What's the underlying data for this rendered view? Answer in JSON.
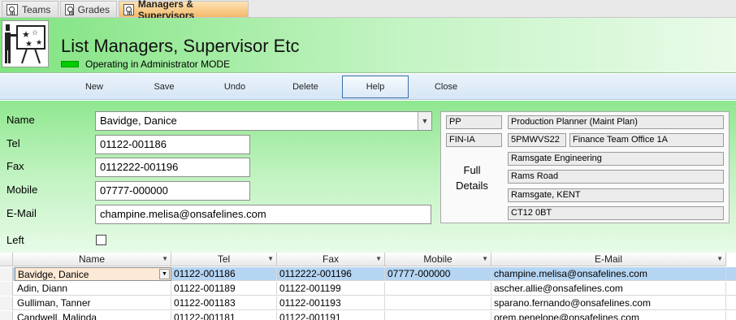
{
  "tabs": [
    {
      "label": "Teams",
      "active": false
    },
    {
      "label": "Grades",
      "active": false
    },
    {
      "label": "Managers & Supervisors",
      "active": true
    }
  ],
  "header": {
    "title": "List Managers, Supervisor Etc",
    "mode_text": "Operating in Administrator MODE",
    "mode_color": "#00cc00"
  },
  "toolbar": {
    "new_label": "New",
    "save_label": "Save",
    "undo_label": "Undo",
    "delete_label": "Delete",
    "help_label": "Help",
    "close_label": "Close"
  },
  "form": {
    "name_label": "Name",
    "name_value": "Bavidge, Danice",
    "tel_label": "Tel",
    "tel_value": "01122-001186",
    "fax_label": "Fax",
    "fax_value": "0112222-001196",
    "mobile_label": "Mobile",
    "mobile_value": "07777-000000",
    "email_label": "E-Mail",
    "email_value": "champine.melisa@onsafelines.com",
    "left_label": "Left",
    "left_checked": false
  },
  "details": {
    "full_details_label": "Full Details",
    "grade_code": "PP",
    "grade_name": "Production Planner (Maint Plan)",
    "team_code": "FIN-IA",
    "office_code": "5PMWVS22",
    "office_name": "Finance Team Office 1A",
    "address_line1": "Ramsgate Engineering",
    "address_line2": "Rams Road",
    "address_line3": "Ramsgate, KENT",
    "postcode": "CT12 0BT"
  },
  "grid": {
    "columns": [
      "Name",
      "Tel",
      "Fax",
      "Mobile",
      "E-Mail"
    ],
    "rows": [
      {
        "name": "Bavidge, Danice",
        "tel": "01122-001186",
        "fax": "0112222-001196",
        "mobile": "07777-000000",
        "email": "champine.melisa@onsafelines.com"
      },
      {
        "name": "Adin, Diann",
        "tel": "01122-001189",
        "fax": "01122-001199",
        "mobile": "",
        "email": "ascher.allie@onsafelines.com"
      },
      {
        "name": "Gulliman, Tanner",
        "tel": "01122-001183",
        "fax": "01122-001193",
        "mobile": "",
        "email": "sparano.fernando@onsafelines.com"
      },
      {
        "name": "Candwell, Malinda",
        "tel": "01122-001181",
        "fax": "01122-001191",
        "mobile": "",
        "email": "orem.penelope@onsafelines.com"
      }
    ]
  }
}
